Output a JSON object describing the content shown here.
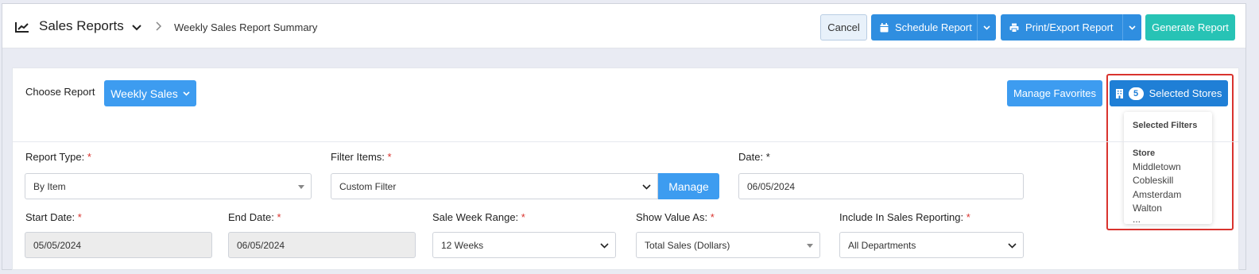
{
  "header": {
    "app_title": "Sales Reports",
    "breadcrumb": "Weekly Sales Report Summary",
    "buttons": {
      "cancel": "Cancel",
      "schedule": "Schedule Report",
      "print_export": "Print/Export Report",
      "generate": "Generate Report"
    }
  },
  "report_chooser": {
    "label": "Choose Report",
    "selected": "Weekly Sales",
    "manage_favorites": "Manage Favorites",
    "stores_count": "5",
    "stores_label": "Selected Stores"
  },
  "filters_popover": {
    "title": "Selected Filters",
    "section": "Store",
    "stores": [
      "Middletown",
      "Cobleskill",
      "Amsterdam",
      "Walton",
      "..."
    ]
  },
  "form": {
    "report_type": {
      "label": "Report Type:",
      "value": "By Item"
    },
    "filter_items": {
      "label": "Filter Items:",
      "value": "Custom Filter",
      "manage": "Manage"
    },
    "date": {
      "label": "Date:",
      "value": "06/05/2024"
    },
    "start_date": {
      "label": "Start Date:",
      "value": "05/05/2024"
    },
    "end_date": {
      "label": "End Date:",
      "value": "06/05/2024"
    },
    "sale_week_range": {
      "label": "Sale Week Range:",
      "value": "12 Weeks"
    },
    "show_value_as": {
      "label": "Show Value As:",
      "value": "Total Sales (Dollars)"
    },
    "include_in_sales": {
      "label": "Include In Sales Reporting:",
      "value": "All Departments"
    },
    "required_mark": "*"
  },
  "colors": {
    "primary": "#3d9cf0",
    "primary_dark": "#1f7fd6",
    "teal": "#27c3b5",
    "required": "#d9332e",
    "highlight": "#d9332e"
  }
}
